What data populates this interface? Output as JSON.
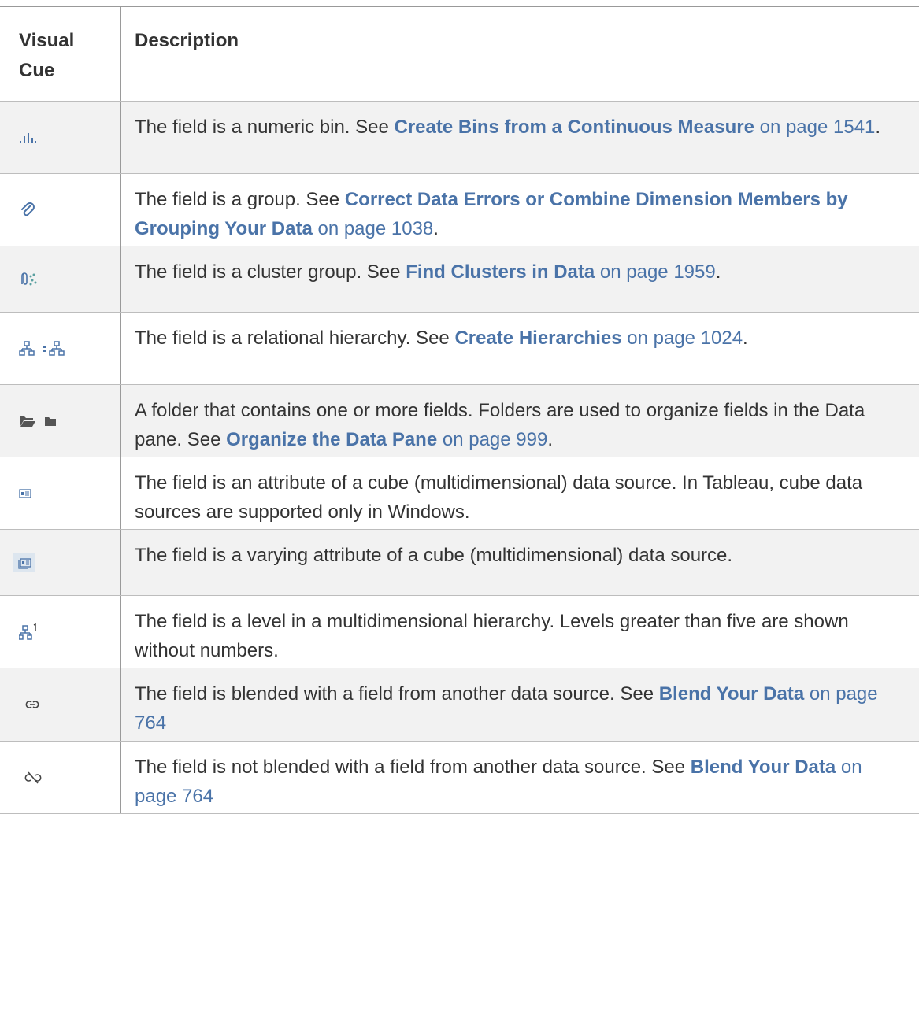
{
  "header": {
    "cue": "Visual Cue",
    "description": "Description"
  },
  "rows": [
    {
      "icon": "numeric-bin-icon",
      "pre": "The field is a numeric bin. See ",
      "link": "Create Bins from a Continuous Measure",
      "post_link": " on page 1541",
      "tail": "."
    },
    {
      "icon": "group-paperclip-icon",
      "pre": "The field is a group. See ",
      "link": "Correct Data Errors or Combine Dimension Members by Grouping Your Data",
      "post_link": " on page 1038",
      "tail": "."
    },
    {
      "icon": "cluster-group-icon",
      "pre": "The field is a cluster group. See ",
      "link": "Find Clusters in Data",
      "post_link": " on page 1959",
      "tail": "."
    },
    {
      "icon": "relational-hierarchy-icon",
      "pre": "The field is a relational hierarchy. See ",
      "link": "Create Hierarchies",
      "post_link": " on page 1024",
      "tail": "."
    },
    {
      "icon": "folder-icon",
      "pre": "A folder that contains one or more fields. Folders are used to organize fields in the Data pane. See ",
      "link": "Organize the Data Pane",
      "post_link": " on page 999",
      "tail": "."
    },
    {
      "icon": "cube-attribute-icon",
      "pre": "The field is an attribute of a cube (multidimensional) data source. In Tableau, cube data sources are supported only in Windows.",
      "link": "",
      "post_link": "",
      "tail": ""
    },
    {
      "icon": "varying-attribute-icon",
      "pre": "The field is a varying attribute of a cube (multidimensional) data source.",
      "link": "",
      "post_link": "",
      "tail": ""
    },
    {
      "icon": "hierarchy-level-icon",
      "pre": "The field is a level in a multidimensional hierarchy. Levels greater than five are shown without numbers.",
      "link": "",
      "post_link": "",
      "tail": ""
    },
    {
      "icon": "blend-link-icon",
      "pre": "The field is blended with a field from another data source. See ",
      "link": "Blend Your Data",
      "post_link": " on page 764",
      "tail": ""
    },
    {
      "icon": "blend-broken-link-icon",
      "pre": "The field is not blended with a field from another data source. See ",
      "link": "Blend Your Data",
      "post_link": " on page 764",
      "tail": ""
    }
  ]
}
